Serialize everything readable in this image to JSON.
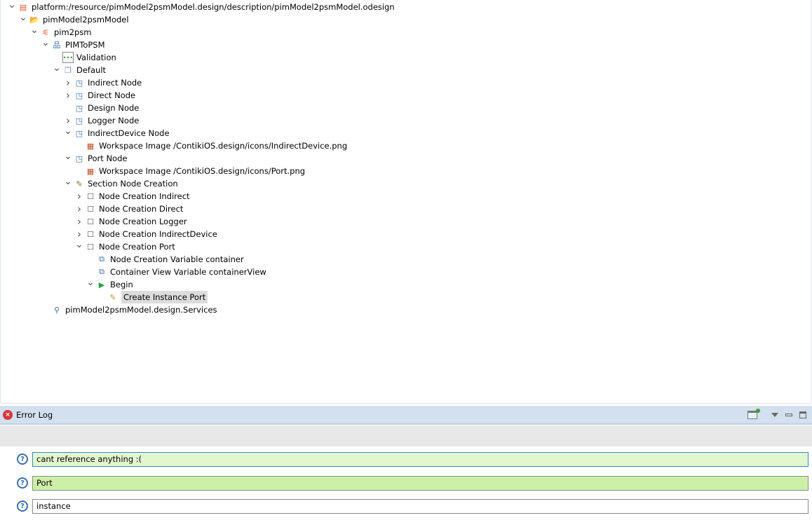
{
  "tree": [
    {
      "label": "platform:/resource/pimModel2psmModel.design/description/pimModel2psmModel.odesign",
      "level": 0,
      "exp": "down",
      "icon": "odesign-file-icon"
    },
    {
      "label": "pimModel2psmModel",
      "level": 1,
      "exp": "down",
      "icon": "group-folder-icon"
    },
    {
      "label": "pim2psm",
      "level": 2,
      "exp": "down",
      "icon": "viewpoint-icon"
    },
    {
      "label": "PIMToPSM",
      "level": 3,
      "exp": "down",
      "icon": "diagram-description-icon"
    },
    {
      "label": "Validation",
      "level": 4,
      "exp": "",
      "icon": "validation-icon"
    },
    {
      "label": "Default",
      "level": 4,
      "exp": "down",
      "icon": "layer-icon"
    },
    {
      "label": "Indirect Node",
      "level": 5,
      "exp": "right",
      "icon": "node-mapping-icon"
    },
    {
      "label": "Direct Node",
      "level": 5,
      "exp": "right",
      "icon": "node-mapping-icon"
    },
    {
      "label": "Design Node",
      "level": 5,
      "exp": "",
      "icon": "node-mapping-icon"
    },
    {
      "label": "Logger Node",
      "level": 5,
      "exp": "right",
      "icon": "node-mapping-icon"
    },
    {
      "label": "IndirectDevice Node",
      "level": 5,
      "exp": "down",
      "icon": "node-mapping-icon"
    },
    {
      "label": "Workspace Image /ContikiOS.design/icons/IndirectDevice.png",
      "level": 6,
      "exp": "",
      "icon": "workspace-image-icon"
    },
    {
      "label": "Port Node",
      "level": 5,
      "exp": "down",
      "icon": "node-mapping-icon"
    },
    {
      "label": "Workspace Image /ContikiOS.design/icons/Port.png",
      "level": 6,
      "exp": "",
      "icon": "workspace-image-icon"
    },
    {
      "label": "Section Node Creation",
      "level": 5,
      "exp": "down",
      "icon": "tool-section-icon"
    },
    {
      "label": "Node Creation Indirect",
      "level": 6,
      "exp": "right",
      "icon": "node-creation-icon"
    },
    {
      "label": "Node Creation Direct",
      "level": 6,
      "exp": "right",
      "icon": "node-creation-icon"
    },
    {
      "label": "Node Creation Logger",
      "level": 6,
      "exp": "right",
      "icon": "node-creation-icon"
    },
    {
      "label": "Node Creation IndirectDevice",
      "level": 6,
      "exp": "right",
      "icon": "node-creation-icon"
    },
    {
      "label": "Node Creation Port",
      "level": 6,
      "exp": "down",
      "icon": "node-creation-icon"
    },
    {
      "label": "Node Creation Variable container",
      "level": 7,
      "exp": "",
      "icon": "variable-icon"
    },
    {
      "label": "Container View Variable containerView",
      "level": 7,
      "exp": "",
      "icon": "variable-icon"
    },
    {
      "label": "Begin",
      "level": 7,
      "exp": "down",
      "icon": "begin-icon"
    },
    {
      "label": "Create Instance Port",
      "level": 8,
      "exp": "",
      "icon": "create-instance-icon",
      "selected": true
    },
    {
      "label": "pimModel2psmModel.design.Services",
      "level": 3,
      "exp": "",
      "icon": "java-extension-icon"
    }
  ],
  "panel": {
    "title": "Error Log"
  },
  "fields": [
    {
      "value": "cant reference anything :(",
      "bg": "#e3f7cf",
      "border": "#3a7fd0"
    },
    {
      "value": "Port",
      "bg": "#cdf0a8",
      "border": "#8a8a8a"
    },
    {
      "value": "instance",
      "bg": "#ffffff",
      "border": "#8a8a8a"
    }
  ]
}
